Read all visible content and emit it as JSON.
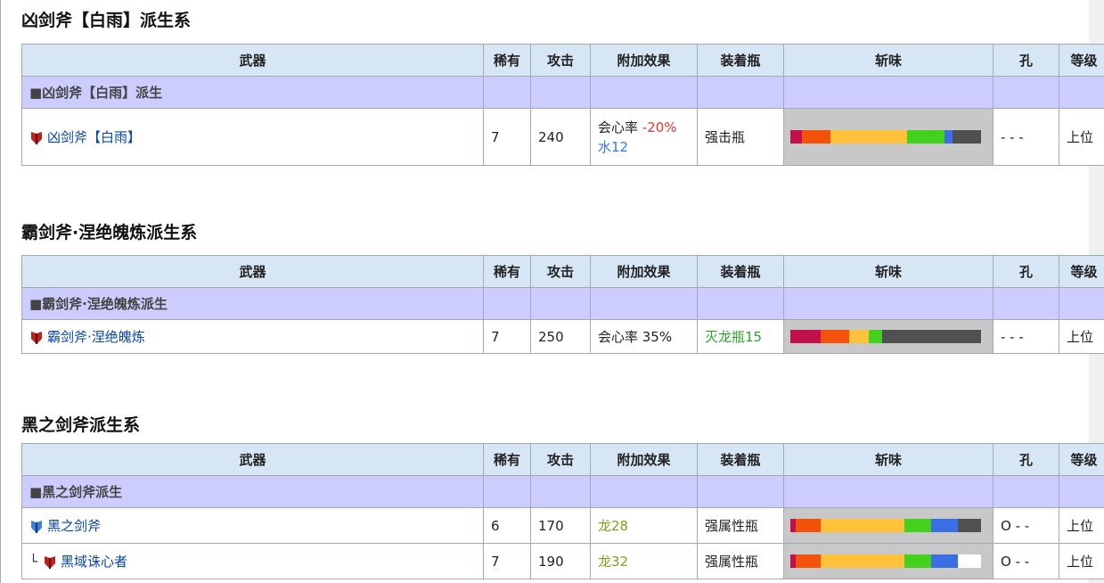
{
  "headers": {
    "weapon": "武器",
    "rarity": "稀有",
    "attack": "攻击",
    "effect": "附加效果",
    "phial": "装着瓶",
    "sharpness": "斩味",
    "slots": "孔",
    "rank": "等级"
  },
  "sharp_colors": {
    "red": "#c0114e",
    "orange": "#f4520a",
    "yellow": "#fdc13a",
    "green": "#44d11d",
    "blue": "#3a6fe6",
    "white": "#ffffff",
    "empty": "#505050"
  },
  "sections": [
    {
      "title": "凶剑斧【白雨】派生系",
      "group": "■凶剑斧【白雨】派生",
      "rows": [
        {
          "icon": "red",
          "name": "凶剑斧【白雨】",
          "rarity": "7",
          "attack": "240",
          "effect1": "会心率 ",
          "effect1_val": "-20%",
          "effect2": "水12",
          "phial": "强击瓶",
          "slots": "- - -",
          "rank": "上位",
          "sharpness": [
            [
              "red",
              6
            ],
            [
              "orange",
              15
            ],
            [
              "yellow",
              40
            ],
            [
              "green",
              20
            ],
            [
              "blue",
              4
            ],
            [
              "empty",
              15
            ]
          ]
        }
      ]
    },
    {
      "title": "霸剑斧·涅绝魄炼派生系",
      "group": "■霸剑斧·涅绝魄炼派生",
      "rows": [
        {
          "icon": "red",
          "name": "霸剑斧·涅绝魄炼",
          "rarity": "7",
          "attack": "250",
          "effect1": "会心率 35%",
          "phial": "灭龙瓶15",
          "slots": "- - -",
          "rank": "上位",
          "sharpness": [
            [
              "red",
              16
            ],
            [
              "orange",
              15
            ],
            [
              "yellow",
              10
            ],
            [
              "green",
              7
            ],
            [
              "empty",
              52
            ]
          ]
        }
      ]
    },
    {
      "title": "黑之剑斧派生系",
      "group": "■黑之剑斧派生",
      "rows": [
        {
          "icon": "blue",
          "name": "黑之剑斧",
          "rarity": "6",
          "attack": "170",
          "effect1": "龙28",
          "phial": "强属性瓶",
          "slots": "O - -",
          "rank": "上位",
          "sharpness": [
            [
              "red",
              3
            ],
            [
              "orange",
              13
            ],
            [
              "yellow",
              44
            ],
            [
              "green",
              14
            ],
            [
              "blue",
              14
            ],
            [
              "empty",
              12
            ]
          ]
        },
        {
          "icon": "red",
          "branch": "└",
          "name": "黑域诛心者",
          "rarity": "7",
          "attack": "190",
          "effect1": "龙32",
          "phial": "强属性瓶",
          "slots": "O - -",
          "rank": "上位",
          "sharpness": [
            [
              "red",
              3
            ],
            [
              "orange",
              13
            ],
            [
              "yellow",
              44
            ],
            [
              "green",
              14
            ],
            [
              "blue",
              14
            ],
            [
              "white",
              12
            ]
          ]
        }
      ]
    }
  ]
}
